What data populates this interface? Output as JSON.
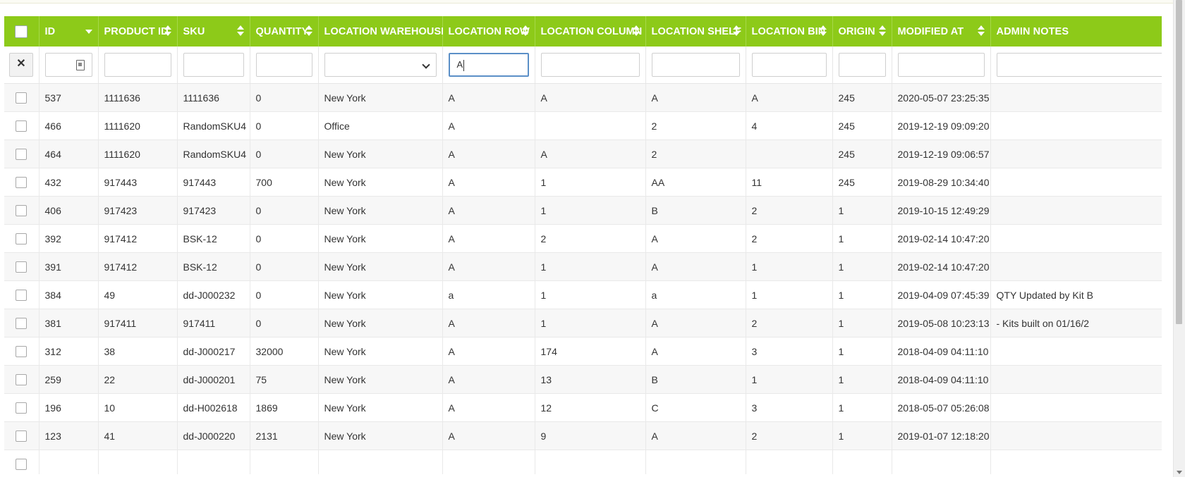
{
  "columns": [
    {
      "key": "select",
      "label": ""
    },
    {
      "key": "id",
      "label": "ID"
    },
    {
      "key": "product_id",
      "label": "PRODUCT ID"
    },
    {
      "key": "sku",
      "label": "SKU"
    },
    {
      "key": "quantity",
      "label": "QUANTITY"
    },
    {
      "key": "location_warehouse",
      "label": "LOCATION WAREHOUSE"
    },
    {
      "key": "location_row",
      "label": "LOCATION ROW"
    },
    {
      "key": "location_column",
      "label": "LOCATION COLUMN"
    },
    {
      "key": "location_shelf",
      "label": "LOCATION SHELF"
    },
    {
      "key": "location_bin",
      "label": "LOCATION BIN"
    },
    {
      "key": "origin",
      "label": "ORIGIN"
    },
    {
      "key": "modified_at",
      "label": "MODIFIED AT"
    },
    {
      "key": "admin_notes",
      "label": "ADMIN NOTES"
    }
  ],
  "filters": {
    "clear_label": "✕",
    "location_row_value": "A",
    "location_warehouse_selected": ""
  },
  "rows": [
    [
      "537",
      "1111636",
      "1111636",
      "0",
      "New York",
      "A",
      "A",
      "A",
      "A",
      "245",
      "2020-05-07 23:25:35",
      ""
    ],
    [
      "466",
      "1111620",
      "RandomSKU4",
      "0",
      "Office",
      "A",
      "",
      "2",
      "4",
      "245",
      "2019-12-19 09:09:20",
      ""
    ],
    [
      "464",
      "1111620",
      "RandomSKU4",
      "0",
      "New York",
      "A",
      "A",
      "2",
      "",
      "245",
      "2019-12-19 09:06:57",
      ""
    ],
    [
      "432",
      "917443",
      "917443",
      "700",
      "New York",
      "A",
      "1",
      "AA",
      "11",
      "245",
      "2019-08-29 10:34:40",
      ""
    ],
    [
      "406",
      "917423",
      "917423",
      "0",
      "New York",
      "A",
      "1",
      "B",
      "2",
      "1",
      "2019-10-15 12:49:29",
      ""
    ],
    [
      "392",
      "917412",
      "BSK-12",
      "0",
      "New York",
      "A",
      "2",
      "A",
      "2",
      "1",
      "2019-02-14 10:47:20",
      ""
    ],
    [
      "391",
      "917412",
      "BSK-12",
      "0",
      "New York",
      "A",
      "1",
      "A",
      "1",
      "1",
      "2019-02-14 10:47:20",
      ""
    ],
    [
      "384",
      "49",
      "dd-J000232",
      "0",
      "New York",
      "a",
      "1",
      "a",
      "1",
      "1",
      "2019-04-09 07:45:39",
      "QTY Updated by Kit B"
    ],
    [
      "381",
      "917411",
      "917411",
      "0",
      "New York",
      "A",
      "1",
      "A",
      "2",
      "1",
      "2019-05-08 10:23:13",
      "- Kits built on 01/16/2"
    ],
    [
      "312",
      "38",
      "dd-J000217",
      "32000",
      "New York",
      "A",
      "174",
      "A",
      "3",
      "1",
      "2018-04-09 04:11:10",
      ""
    ],
    [
      "259",
      "22",
      "dd-J000201",
      "75",
      "New York",
      "A",
      "13",
      "B",
      "1",
      "1",
      "2018-04-09 04:11:10",
      ""
    ],
    [
      "196",
      "10",
      "dd-H002618",
      "1869",
      "New York",
      "A",
      "12",
      "C",
      "3",
      "1",
      "2018-05-07 05:26:08",
      ""
    ],
    [
      "123",
      "41",
      "dd-J000220",
      "2131",
      "New York",
      "A",
      "9",
      "A",
      "2",
      "1",
      "2019-01-07 12:18:20",
      ""
    ],
    [
      "",
      "",
      "",
      "",
      "",
      "",
      "",
      "",
      "",
      "",
      "",
      ""
    ]
  ],
  "colors": {
    "header_bg": "#8dca19",
    "header_text": "#ffffff",
    "focus_border": "#5b8fc7"
  }
}
